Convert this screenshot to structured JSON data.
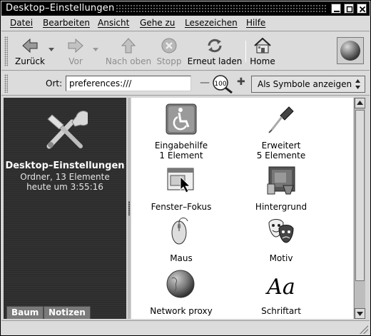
{
  "window": {
    "title": "Desktop–Einstellungen"
  },
  "menubar": {
    "items": [
      {
        "label": "Datei"
      },
      {
        "label": "Bearbeiten"
      },
      {
        "label": "Ansicht"
      },
      {
        "label": "Gehe zu"
      },
      {
        "label": "Lesezeichen"
      },
      {
        "label": "Hilfe"
      }
    ]
  },
  "toolbar": {
    "back_label": "Zurück",
    "forward_label": "Vor",
    "up_label": "Nach oben",
    "stop_label": "Stopp",
    "reload_label": "Erneut laden",
    "home_label": "Home"
  },
  "location": {
    "label": "Ort:",
    "value": "preferences:///",
    "zoom_level": "100",
    "view_mode": "Als Symbole anzeigen"
  },
  "sidebar": {
    "title": "Desktop–Einstellungen",
    "info": "Ordner, 13 Elemente",
    "modified": "heute um 3:55:16",
    "tabs": [
      {
        "label": "Baum"
      },
      {
        "label": "Notizen"
      }
    ]
  },
  "items": [
    {
      "name": "Eingabehilfe",
      "sub": "1 Element",
      "icon": "accessibility-icon"
    },
    {
      "name": "Erweitert",
      "sub": "5 Elemente",
      "icon": "screwdriver-icon"
    },
    {
      "name": "Fenster–Fokus",
      "sub": "",
      "icon": "window-focus-icon"
    },
    {
      "name": "Hintergrund",
      "sub": "",
      "icon": "background-icon"
    },
    {
      "name": "Maus",
      "sub": "",
      "icon": "mouse-icon"
    },
    {
      "name": "Motiv",
      "sub": "",
      "icon": "theme-masks-icon"
    },
    {
      "name": "Network proxy",
      "sub": "",
      "icon": "network-globe-icon"
    },
    {
      "name": "Schriftart",
      "sub": "",
      "icon": "font-icon"
    }
  ]
}
